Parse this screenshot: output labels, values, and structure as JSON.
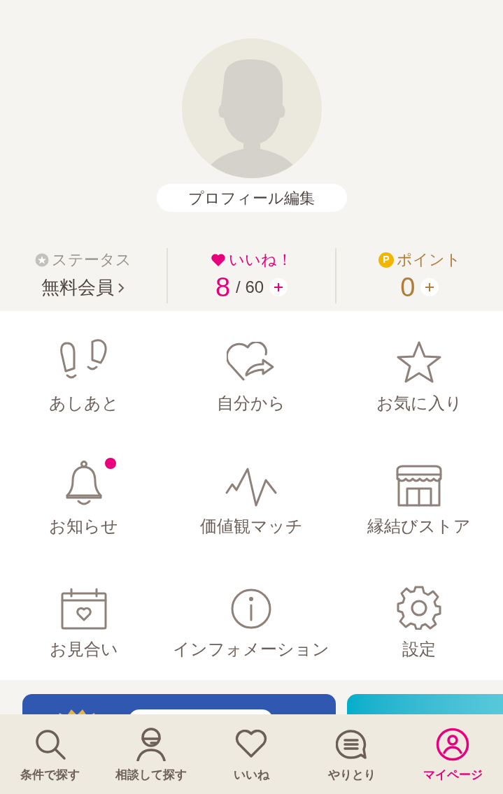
{
  "profile": {
    "edit_button": "プロフィール編集"
  },
  "stats": {
    "status": {
      "label": "ステータス",
      "value": "無料会員"
    },
    "likes": {
      "label": "いいね！",
      "count": "8",
      "limit": "/ 60"
    },
    "points": {
      "badge": "P",
      "label": "ポイント",
      "value": "0"
    }
  },
  "menu": [
    {
      "kind": "footprints",
      "label": "あしあと",
      "notification": false
    },
    {
      "kind": "heart-share",
      "label": "自分から",
      "notification": false
    },
    {
      "kind": "star",
      "label": "お気に入り",
      "notification": false
    },
    {
      "kind": "bell",
      "label": "お知らせ",
      "notification": true
    },
    {
      "kind": "wave",
      "label": "価値観マッチ",
      "notification": false
    },
    {
      "kind": "store",
      "label": "縁結びストア",
      "notification": false
    },
    {
      "kind": "calendar",
      "label": "お見合い",
      "notification": false
    },
    {
      "kind": "info",
      "label": "インフォメーション",
      "notification": false
    },
    {
      "kind": "gear",
      "label": "設定",
      "notification": false
    }
  ],
  "tab_bar": [
    {
      "kind": "search",
      "label": "条件で探す",
      "selected": false
    },
    {
      "kind": "consult",
      "label": "相談して探す",
      "selected": false
    },
    {
      "kind": "heart",
      "label": "いいね",
      "selected": false
    },
    {
      "kind": "chat",
      "label": "やりとり",
      "selected": false
    },
    {
      "kind": "person",
      "label": "マイページ",
      "selected": true
    }
  ]
}
